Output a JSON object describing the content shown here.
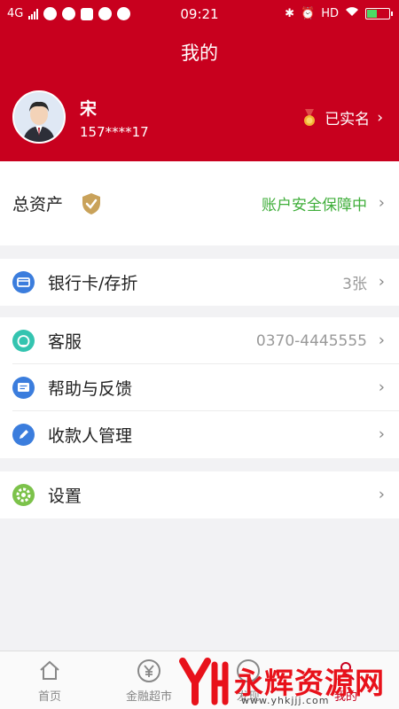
{
  "status_bar": {
    "network": "4G",
    "time": "09:21",
    "hd": "HD"
  },
  "header": {
    "title": "我的"
  },
  "profile": {
    "name": "宋",
    "phone": "157****17",
    "verified_label": "已实名"
  },
  "assets": {
    "label": "总资产",
    "security_text": "账户安全保障中"
  },
  "menu": {
    "bank_cards": {
      "label": "银行卡/存折",
      "value": "3张"
    },
    "customer_service": {
      "label": "客服",
      "value": "0370-4445555"
    },
    "help_feedback": {
      "label": "帮助与反馈"
    },
    "payee_management": {
      "label": "收款人管理"
    },
    "settings": {
      "label": "设置"
    }
  },
  "bottom_nav": {
    "items": [
      {
        "label": "首页",
        "icon": "home-icon"
      },
      {
        "label": "金融超市",
        "icon": "yuan-icon"
      },
      {
        "label": "发现",
        "icon": "discover-icon"
      },
      {
        "label": "我的",
        "icon": "user-icon"
      }
    ]
  },
  "watermark": {
    "text": "永辉资源网",
    "url": "www.yhkjjj.com"
  },
  "colors": {
    "brand_red": "#c8001e",
    "safe_green": "#3fae3a",
    "bank_icon": "#3b7ddd",
    "service_icon": "#34c4b0",
    "settings_icon": "#7cc24a"
  }
}
